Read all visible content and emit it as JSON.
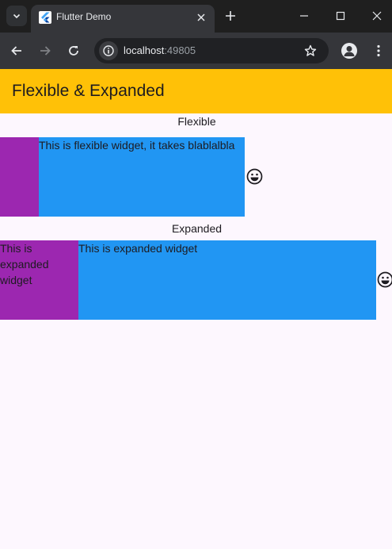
{
  "browser": {
    "tab_title": "Flutter Demo",
    "url_host": "localhost",
    "url_port": ":49805"
  },
  "app": {
    "title": "Flexible & Expanded",
    "flexible_section": {
      "label": "Flexible",
      "purple_text": "",
      "blue_text": "This is flexible widget, it takes blablalbla"
    },
    "expanded_section": {
      "label": "Expanded",
      "purple_text": "This is expanded widget",
      "blue_text": "This is expanded widget"
    }
  },
  "colors": {
    "appbar": "#ffc107",
    "purple": "#9c27b0",
    "blue": "#2196f3",
    "background": "#fdf7fe"
  },
  "icons": {
    "emoji": "smile-icon"
  }
}
